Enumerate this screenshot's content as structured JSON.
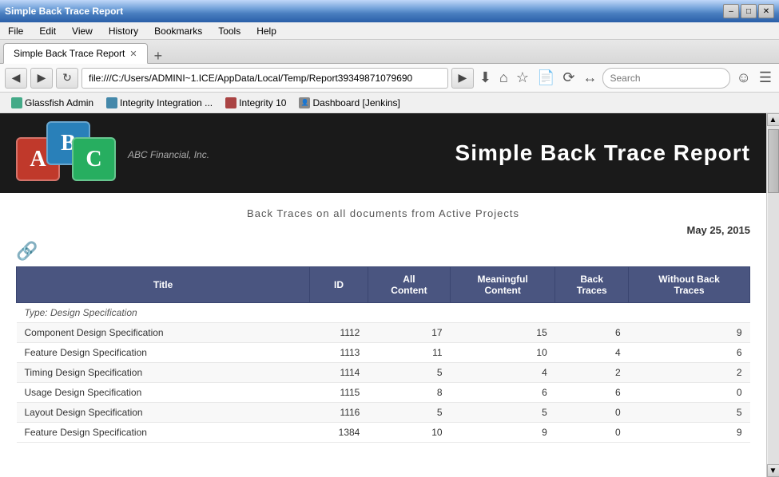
{
  "titlebar": {
    "title": "Simple Back Trace Report",
    "controls": [
      "minimize",
      "maximize",
      "close"
    ]
  },
  "menubar": {
    "items": [
      "File",
      "Edit",
      "View",
      "History",
      "Bookmarks",
      "Tools",
      "Help"
    ]
  },
  "tabs": [
    {
      "label": "Simple Back Trace Report",
      "active": true
    },
    {
      "label": "+",
      "new": true
    }
  ],
  "addressbar": {
    "url": "file:///C:/Users/ADMINI~1.ICE/AppData/Local/Temp/Report39349871079690",
    "search_placeholder": "Search"
  },
  "bookmarks": [
    {
      "label": "Glassfish Admin",
      "favicon": "green"
    },
    {
      "label": "Integrity Integration ...",
      "favicon": "blue"
    },
    {
      "label": "Integrity 10",
      "favicon": "red"
    },
    {
      "label": "Dashboard [Jenkins]",
      "favicon": "gray"
    }
  ],
  "report": {
    "logo_a": "A",
    "logo_b": "B",
    "logo_c": "C",
    "company": "ABC Financial, Inc.",
    "title": "Simple Back Trace Report",
    "subtitle": "Back Traces on all documents from Active Projects",
    "date": "May 25, 2015",
    "table": {
      "columns": [
        "Title",
        "ID",
        "All\nContent",
        "Meaningful\nContent",
        "Back\nTraces",
        "Without Back\nTraces"
      ],
      "type_label": "Type: Design Specification",
      "rows": [
        {
          "title": "Component Design Specification",
          "id": "1112",
          "all": "17",
          "meaningful": "15",
          "back": "6",
          "without": "9"
        },
        {
          "title": "Feature Design Specification",
          "id": "1113",
          "all": "11",
          "meaningful": "10",
          "back": "4",
          "without": "6"
        },
        {
          "title": "Timing Design Specification",
          "id": "1114",
          "all": "5",
          "meaningful": "4",
          "back": "2",
          "without": "2"
        },
        {
          "title": "Usage Design Specification",
          "id": "1115",
          "all": "8",
          "meaningful": "6",
          "back": "6",
          "without": "0"
        },
        {
          "title": "Layout Design Specification",
          "id": "1116",
          "all": "5",
          "meaningful": "5",
          "back": "0",
          "without": "5"
        },
        {
          "title": "Feature Design Specification",
          "id": "1384",
          "all": "10",
          "meaningful": "9",
          "back": "0",
          "without": "9"
        }
      ]
    }
  }
}
